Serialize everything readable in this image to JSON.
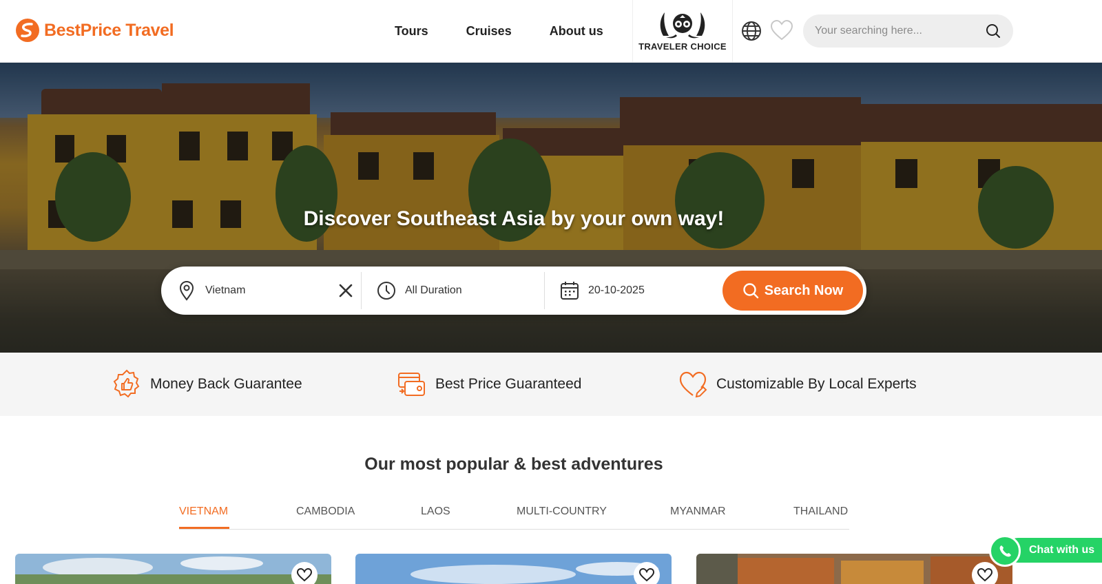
{
  "brand": {
    "name": "BestPrice Travel",
    "accent": "#f26c22"
  },
  "nav": {
    "items": [
      "Tours",
      "Cruises",
      "About us"
    ]
  },
  "award": {
    "label": "TRAVELER CHOICE"
  },
  "header": {
    "search_placeholder": "Your searching here..."
  },
  "hero": {
    "title": "Discover Southeast Asia by your own way!",
    "destination": "Vietnam",
    "duration": "All Duration",
    "date": "20-10-2025",
    "search_button": "Search Now"
  },
  "guarantees": [
    {
      "label": "Money Back Guarantee",
      "icon": "thumbs-up-badge-icon"
    },
    {
      "label": "Best Price Guaranteed",
      "icon": "card-exchange-icon"
    },
    {
      "label": "Customizable By Local Experts",
      "icon": "heart-pen-icon"
    }
  ],
  "section": {
    "title": "Our most popular & best adventures"
  },
  "tabs": [
    "VIETNAM",
    "CAMBODIA",
    "LAOS",
    "MULTI-COUNTRY",
    "MYANMAR",
    "THAILAND"
  ],
  "active_tab": "VIETNAM",
  "chat": {
    "label": "Chat with us",
    "color": "#25d366"
  }
}
